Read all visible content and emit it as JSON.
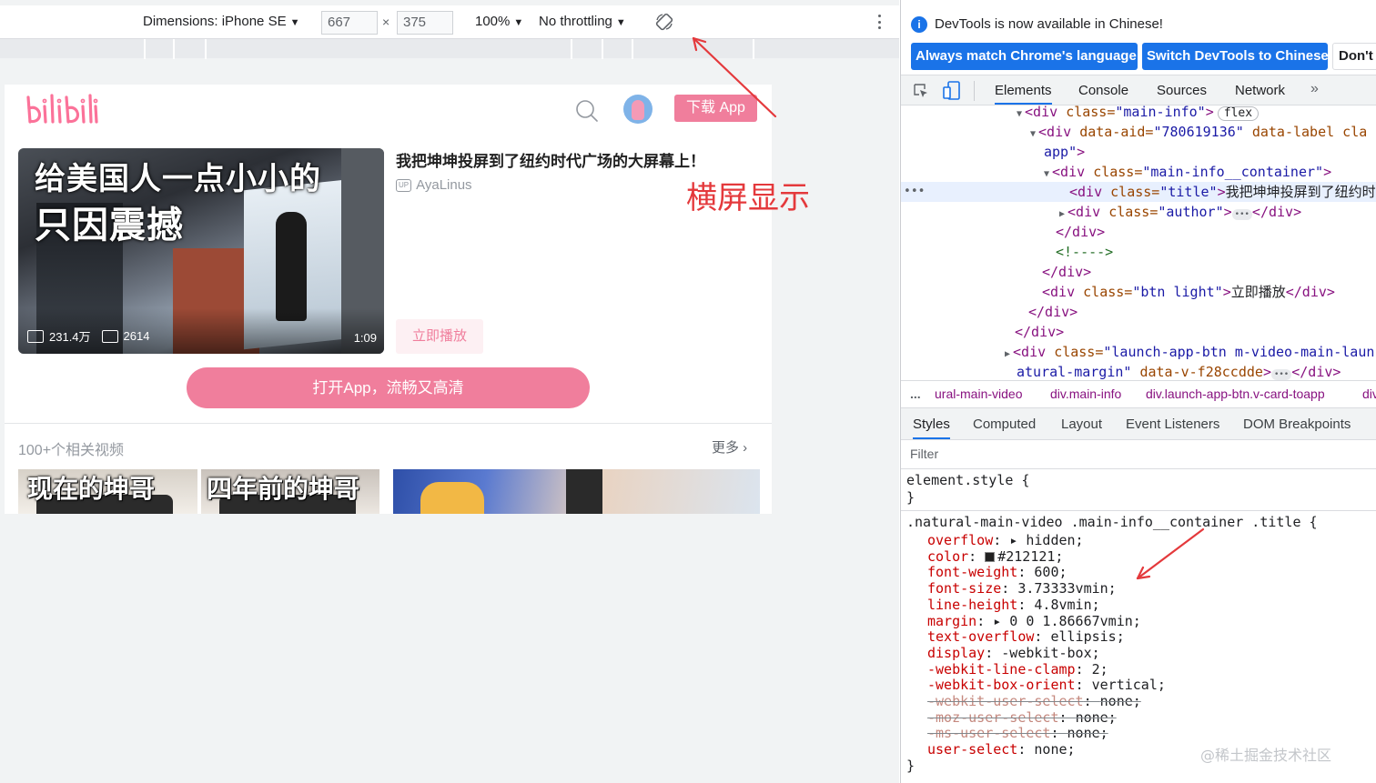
{
  "device_toolbar": {
    "dimensions_label": "Dimensions: iPhone SE",
    "width_value": "667",
    "times": "×",
    "height_value": "375",
    "zoom": "100%",
    "throttling": "No throttling"
  },
  "page": {
    "logo_icon": "bilibili-logo",
    "download_label": "下载 App",
    "video": {
      "overlay_line1": "给美国人一点小小的",
      "overlay_line2": "只因震撼",
      "views": "231.4万",
      "danmaku": "2614",
      "duration": "1:09",
      "title": "我把坤坤投屏到了纽约时代广场的大屏幕上！",
      "up_badge": "UP",
      "author": "AyaLinus",
      "play_label": "立即播放"
    },
    "open_app_label": "打开App，流畅又高清",
    "related_label": "100+个相关视频",
    "more_label": "更多 ›",
    "related_captions": [
      "现在的坤哥",
      "四年前的坤哥"
    ]
  },
  "annotation": {
    "text": "横屏显示",
    "color": "#e4393c"
  },
  "devtools": {
    "info_text": "DevTools is now available in Chinese!",
    "btn_match": "Always match Chrome's language",
    "btn_switch": "Switch DevTools to Chinese",
    "btn_dont": "Don't",
    "tabs": [
      "Elements",
      "Console",
      "Sources",
      "Network"
    ],
    "active_tab": "Elements",
    "dom": {
      "l1_tag_open": "<div ",
      "l1_attr": "class=",
      "l1_val": "\"main-info\"",
      "l1_close": ">",
      "l1_pill": "flex",
      "l2_tag_open": "<div ",
      "l2_attr1": "data-aid=",
      "l2_val1": "\"780619136\"",
      "l2_attr2": " data-label cla",
      "l3_val": "app\"",
      "l3_close": ">",
      "l4_tag_open": "<div ",
      "l4_attr": "class=",
      "l4_val": "\"main-info__container\"",
      "l4_close": ">",
      "l5_tag_open": "<div ",
      "l5_attr": "class=",
      "l5_val": "\"title\"",
      "l5_close": ">",
      "l5_text": "我把坤坤投屏到了纽约时",
      "l6_tag_open": "<div ",
      "l6_attr": "class=",
      "l6_val": "\"author\"",
      "l6_close": ">",
      "l6_end": "</div>",
      "l7": "</div>",
      "l8": "<!---->",
      "l9": "</div>",
      "l10_tag_open": "<div ",
      "l10_attr": "class=",
      "l10_val": "\"btn light\"",
      "l10_close": ">",
      "l10_text": "立即播放",
      "l10_end": "</div>",
      "l11": "</div>",
      "l12": "</div>",
      "l13_tag_open": "<div ",
      "l13_attr": "class=",
      "l13_val": "\"launch-app-btn m-video-main-laun",
      "l14_val": "atural-margin\"",
      "l14_attr": " data-v-f28ccdde",
      "l14_close": ">",
      "l14_end": "</div>",
      "dots": "•••",
      "ellipsis": "•••"
    },
    "breadcrumbs": {
      "dots": "...",
      "c1": "ural-main-video",
      "c2": "div.main-info",
      "c3": "div.launch-app-btn.v-card-toapp",
      "c4": "div"
    },
    "styles_tabs": [
      "Styles",
      "Computed",
      "Layout",
      "Event Listeners",
      "DOM Breakpoints"
    ],
    "filter_placeholder": "Filter",
    "css": {
      "element_style": "element.style {",
      "close": "}",
      "selector": ".natural-main-video .main-info__container .title {",
      "props": [
        {
          "name": "overflow",
          "value": "▸ hidden;",
          "struck": false
        },
        {
          "name": "color",
          "value": "#212121;",
          "struck": false
        },
        {
          "name": "font-weight",
          "value": "600;",
          "struck": false
        },
        {
          "name": "font-size",
          "value": "3.73333vmin;",
          "struck": false
        },
        {
          "name": "line-height",
          "value": "4.8vmin;",
          "struck": false
        },
        {
          "name": "margin",
          "value": "▸ 0 0 1.86667vmin;",
          "struck": false
        },
        {
          "name": "text-overflow",
          "value": "ellipsis;",
          "struck": false
        },
        {
          "name": "display",
          "value": "-webkit-box;",
          "struck": false
        },
        {
          "name": "-webkit-line-clamp",
          "value": "2;",
          "struck": false
        },
        {
          "name": "-webkit-box-orient",
          "value": "vertical;",
          "struck": false
        },
        {
          "name": "-webkit-user-select",
          "value": "none;",
          "struck": true
        },
        {
          "name": "-moz-user-select",
          "value": "none;",
          "struck": true
        },
        {
          "name": "-ms-user-select",
          "value": "none;",
          "struck": true
        },
        {
          "name": "user-select",
          "value": "none;",
          "struck": false
        }
      ],
      "color_swatch": "#212121"
    },
    "watermark": "@稀土掘金技术社区"
  }
}
